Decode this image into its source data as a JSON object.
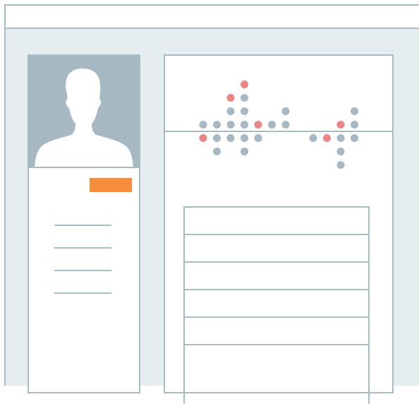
{
  "colors": {
    "frame": "#a8bcc6",
    "panel_bg": "#e5edf0",
    "avatar_bg": "#a6b9c3",
    "badge": "#f78d3a",
    "dot_neutral": "#a6b9c3",
    "dot_highlight": "#ee8584"
  },
  "profile": {
    "avatar_icon": "person-silhouette-icon",
    "detail_line_count": 4
  },
  "chart_data": {
    "type": "scatter",
    "title": "",
    "xlabel": "",
    "ylabel": "",
    "columns": 12,
    "series": [
      {
        "color": "#a6b9c3",
        "points": [
          [
            0,
            1
          ],
          [
            1,
            1
          ],
          [
            2,
            1
          ],
          [
            2,
            2
          ],
          [
            3,
            1
          ],
          [
            3,
            2
          ],
          [
            3,
            3
          ],
          [
            4,
            -1
          ],
          [
            5,
            1
          ],
          [
            6,
            1
          ],
          [
            6,
            2
          ],
          [
            1,
            -1
          ],
          [
            1,
            -2
          ],
          [
            2,
            -1
          ],
          [
            3,
            -1
          ],
          [
            3,
            -2
          ],
          [
            4,
            -1
          ],
          [
            8,
            -1
          ],
          [
            10,
            -1
          ],
          [
            10,
            -2
          ],
          [
            10,
            -3
          ],
          [
            11,
            -1
          ],
          [
            11,
            1
          ],
          [
            11,
            2
          ]
        ]
      },
      {
        "color": "#ee8584",
        "points": [
          [
            2,
            3
          ],
          [
            3,
            4
          ],
          [
            4,
            1
          ],
          [
            9,
            -1
          ],
          [
            10,
            1
          ],
          [
            0,
            -1
          ]
        ]
      }
    ]
  },
  "table": {
    "row_count": 6
  }
}
